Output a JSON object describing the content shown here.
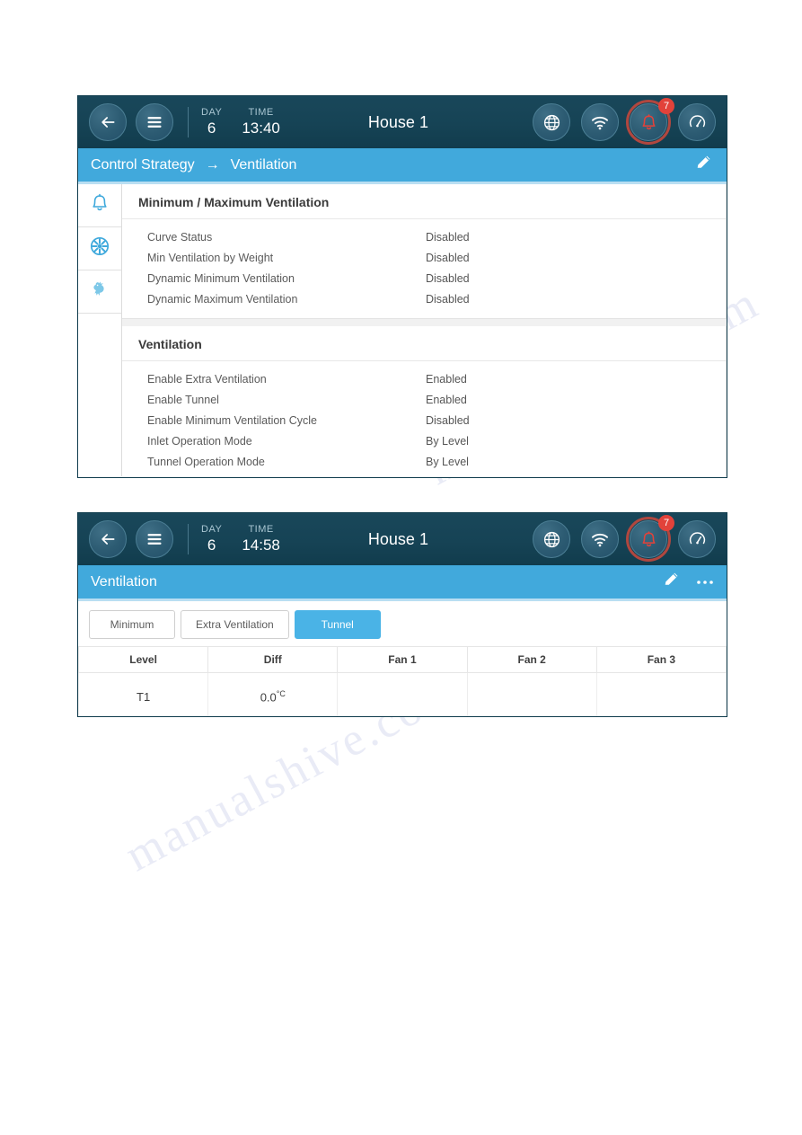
{
  "colors": {
    "topbar_dark": "#164355",
    "accent_blue": "#41a9dc",
    "tab_active": "#4ab3e6",
    "alarm_red": "#e2423a",
    "icon_blue": "#3fa9dc"
  },
  "panels": [
    {
      "id": "control-strategy-ventilation",
      "statusbar": {
        "back_icon": "arrow-left-icon",
        "menu_icon": "hamburger-menu-icon",
        "day_label": "DAY",
        "day_value": "6",
        "time_label": "TIME",
        "time_value": "13:40",
        "house_title": "House 1",
        "icons": [
          {
            "name": "globe-icon",
            "label": "globe"
          },
          {
            "name": "wifi-icon",
            "label": "wifi"
          },
          {
            "name": "alarm-bell-icon",
            "label": "alarm",
            "badge": "7"
          },
          {
            "name": "gauge-icon",
            "label": "gauge"
          }
        ]
      },
      "titlebar": {
        "crumb_parent": "Control Strategy",
        "crumb_arrow": "→",
        "crumb_current": "Ventilation",
        "edit_icon": "pencil-edit-icon"
      },
      "sidebar": [
        {
          "name": "sidebar-item-alarms",
          "icon": "bell-icon"
        },
        {
          "name": "sidebar-item-ventilation",
          "icon": "fan-icon"
        },
        {
          "name": "sidebar-item-flock",
          "icon": "chicken-icon"
        }
      ],
      "cards": [
        {
          "title": "Minimum / Maximum Ventilation",
          "rows": [
            {
              "key": "Curve Status",
              "value": "Disabled"
            },
            {
              "key": "Min Ventilation by Weight",
              "value": "Disabled"
            },
            {
              "key": "Dynamic Minimum Ventilation",
              "value": "Disabled"
            },
            {
              "key": "Dynamic Maximum Ventilation",
              "value": "Disabled"
            }
          ]
        },
        {
          "title": "Ventilation",
          "rows": [
            {
              "key": "Enable Extra Ventilation",
              "value": "Enabled"
            },
            {
              "key": "Enable Tunnel",
              "value": "Enabled"
            },
            {
              "key": "Enable Minimum Ventilation Cycle",
              "value": "Disabled"
            },
            {
              "key": "Inlet Operation Mode",
              "value": "By Level"
            },
            {
              "key": "Tunnel Operation Mode",
              "value": "By Level"
            }
          ]
        }
      ]
    },
    {
      "id": "ventilation-tunnel-table",
      "statusbar": {
        "back_icon": "arrow-left-icon",
        "menu_icon": "hamburger-menu-icon",
        "day_label": "DAY",
        "day_value": "6",
        "time_label": "TIME",
        "time_value": "14:58",
        "house_title": "House 1",
        "icons": [
          {
            "name": "globe-icon",
            "label": "globe"
          },
          {
            "name": "wifi-icon",
            "label": "wifi"
          },
          {
            "name": "alarm-bell-icon",
            "label": "alarm",
            "badge": "7"
          },
          {
            "name": "gauge-icon",
            "label": "gauge"
          }
        ]
      },
      "titlebar": {
        "title": "Ventilation",
        "edit_icon": "pencil-edit-icon",
        "more_icon": "more-options-icon"
      },
      "tabs": [
        {
          "label": "Minimum",
          "active": false
        },
        {
          "label": "Extra Ventilation",
          "active": false
        },
        {
          "label": "Tunnel",
          "active": true
        }
      ],
      "table": {
        "columns": [
          "Level",
          "Diff",
          "Fan 1",
          "Fan 2",
          "Fan 3"
        ],
        "rows": [
          {
            "level": "T1",
            "diff_value": "0.0",
            "diff_unit": "°C",
            "fan1": "",
            "fan2": "",
            "fan3": ""
          }
        ]
      }
    }
  ],
  "watermark": {
    "line_a": "manualshive.com",
    "line_b": "manualshive.com"
  }
}
